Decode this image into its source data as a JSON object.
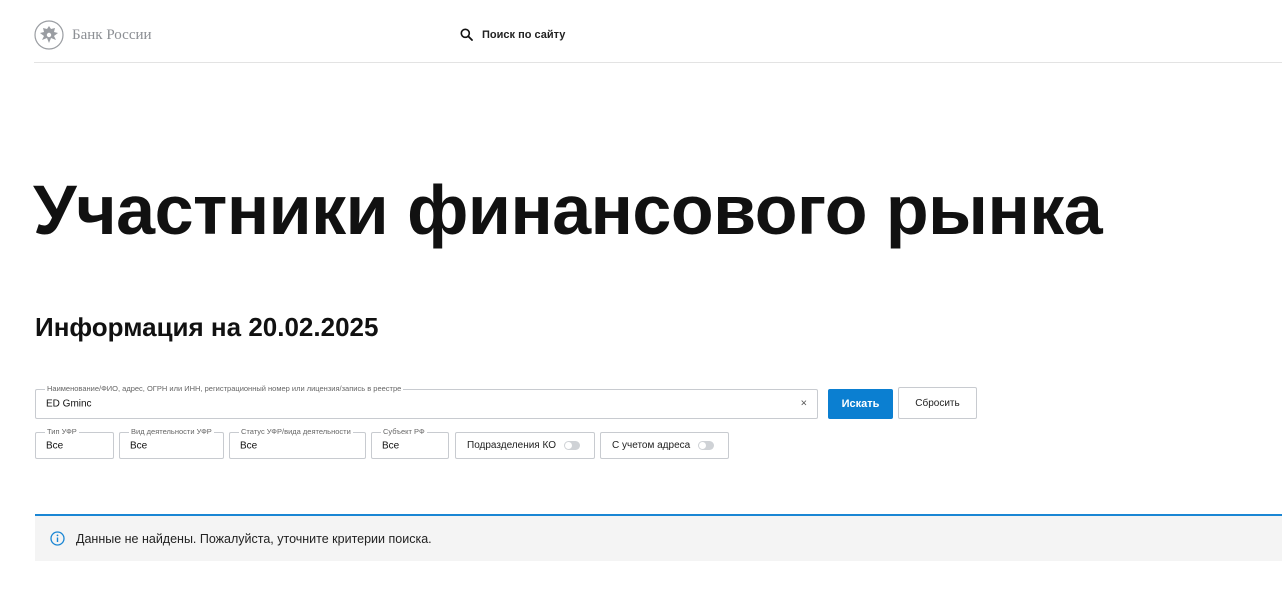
{
  "header": {
    "logo_text": "Банк России",
    "search_label": "Поиск по сайту"
  },
  "page": {
    "title": "Участники финансового рынка",
    "subtitle": "Информация на 20.02.2025"
  },
  "search": {
    "legend": "Наименование/ФИО, адрес, ОГРН или ИНН, регистрационный номер или лицензия/запись в реестре",
    "value": "ED Gminc",
    "clear_glyph": "×",
    "submit_label": "Искать",
    "reset_label": "Сбросить"
  },
  "filters": {
    "type": {
      "legend": "Тип УФР",
      "value": "Все"
    },
    "activity": {
      "legend": "Вид деятельности УФР",
      "value": "Все"
    },
    "status": {
      "legend": "Статус УФР/вида деятельности",
      "value": "Все"
    },
    "region": {
      "legend": "Субъект РФ",
      "value": "Все"
    },
    "branches_toggle": {
      "label": "Подразделения КО",
      "on": false
    },
    "address_toggle": {
      "label": "С учетом адреса",
      "on": false
    }
  },
  "alert": {
    "icon": "info-icon",
    "text": "Данные не найдены. Пожалуйста, уточните критерии поиска."
  },
  "colors": {
    "accent": "#0b7fd1",
    "alert_border": "#1a86d4",
    "logo_gray": "#8c8f94"
  }
}
